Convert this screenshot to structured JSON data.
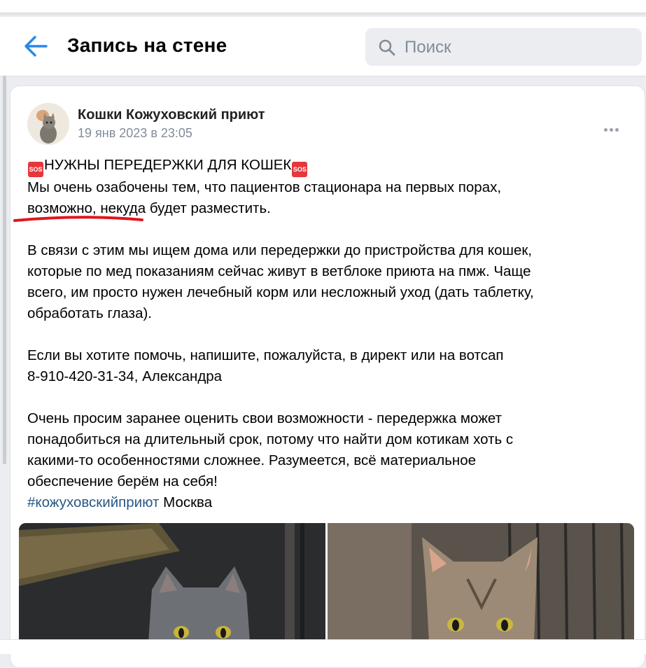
{
  "header": {
    "back_icon": "arrow-left-icon",
    "title": "Запись на стене",
    "search": {
      "placeholder": "Поиск",
      "icon": "search-icon"
    }
  },
  "post": {
    "author": "Кошки Кожуховский приют",
    "date": "19 янв 2023 в 23:05",
    "emoji": "🆘",
    "headline": "НУЖНЫ ПЕРЕДЕРЖКИ ДЛЯ КОШЕК",
    "paragraph1": "Мы очень озабочены тем, что пациентов стационара на первых порах,\nвозможно, некуда будет разместить.",
    "paragraph2": "В связи с этим мы ищем дома или передержки до пристройства для кошек,\nкоторые по мед показаниям сейчас живут в ветблоке приюта на пмж. Чаще\nвсего, им просто нужен лечебный корм или несложный уход (дать таблетку,\nобработать глаза).",
    "paragraph3": "Если вы хотите помочь, напишите, пожалуйста, в директ или на вотсап\n8-910-420-31-34, Александра",
    "paragraph4": "Очень просим заранее оценить свои возможности - передержка может\nпонадобиться на длительный срок, потому что найти дом котикам хоть с\nкакими-то особенностями сложнее. Разумеется, всё материальное\nобеспечение берём на себя!",
    "hashtag": "#кожуховскийприют",
    "location": " Москва"
  },
  "colors": {
    "accent": "#2688eb",
    "link": "#2a5885",
    "secondary_text": "#818c99",
    "underline_marker": "#e0161c"
  }
}
